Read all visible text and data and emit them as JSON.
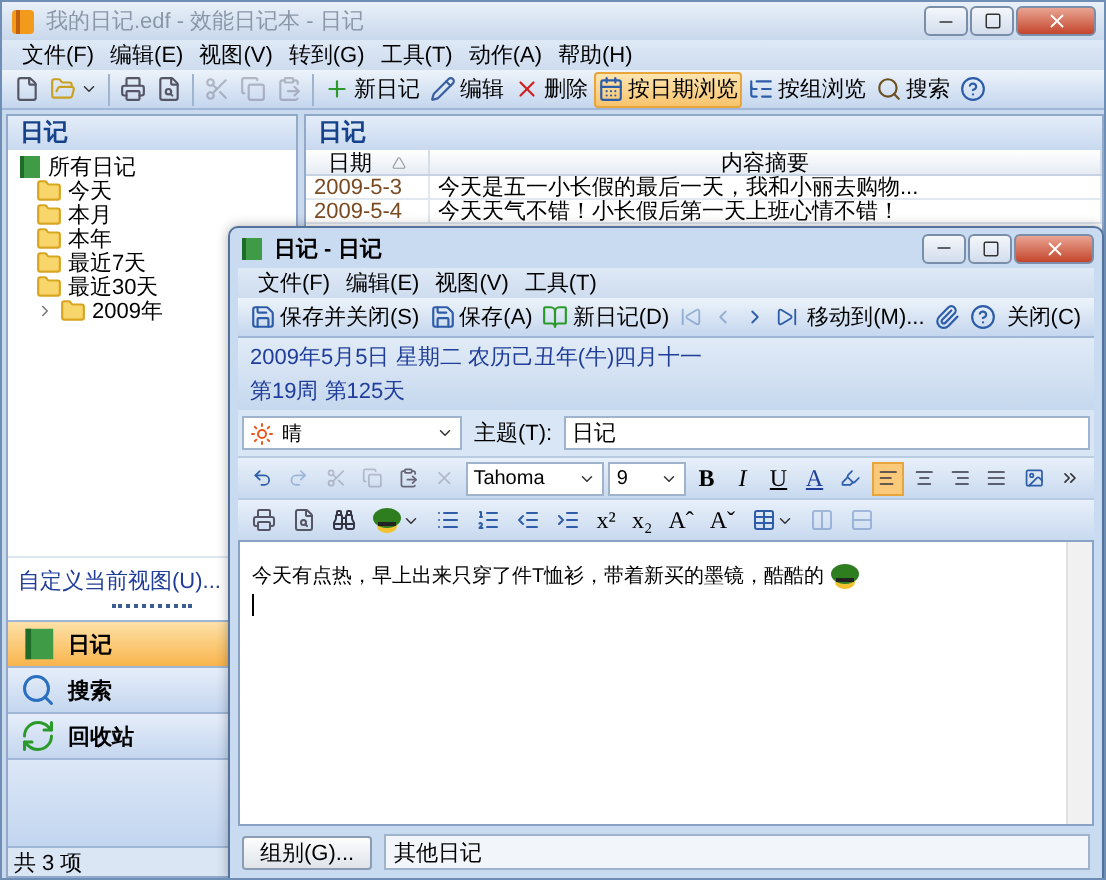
{
  "window": {
    "title": "我的日记.edf - 效能日记本 - 日记"
  },
  "menu": [
    "文件(F)",
    "编辑(E)",
    "视图(V)",
    "转到(G)",
    "工具(T)",
    "动作(A)",
    "帮助(H)"
  ],
  "toolbar": [
    {
      "label": "新日记"
    },
    {
      "label": "编辑"
    },
    {
      "label": "删除"
    },
    {
      "label": "按日期浏览",
      "selected": true
    },
    {
      "label": "按组浏览",
      "selected": false
    },
    {
      "label": "搜索"
    }
  ],
  "sidebar": {
    "title": "日记",
    "tree": [
      {
        "label": "所有日记",
        "children": [
          {
            "label": "今天"
          },
          {
            "label": "本月"
          },
          {
            "label": "本年"
          },
          {
            "label": "最近7天"
          },
          {
            "label": "最近30天"
          },
          {
            "label": "2009年",
            "expanded": false
          }
        ]
      }
    ],
    "customize_link": "自定义当前视图(U)...",
    "nav": [
      {
        "label": "日记",
        "selected": true
      },
      {
        "label": "搜索",
        "selected": false
      },
      {
        "label": "回收站",
        "selected": false
      }
    ],
    "status": "共 3 项"
  },
  "list": {
    "title": "日记",
    "columns": [
      "日期",
      "内容摘要"
    ],
    "rows": [
      [
        "2009-5-3",
        "今天是五一小长假的最后一天，我和小丽去购物..."
      ],
      [
        "2009-5-4",
        "今天天气不错！小长假后第一天上班心情不错！"
      ]
    ]
  },
  "diary_window": {
    "title": "日记 - 日记",
    "menu": [
      "文件(F)",
      "编辑(E)",
      "视图(V)",
      "工具(T)"
    ],
    "toolbar": {
      "save_close": "保存并关闭(S)",
      "save": "保存(A)",
      "new": "新日记(D)",
      "move": "移动到(M)...",
      "close": "关闭(C)"
    },
    "date_line": "2009年5月5日 星期二 农历己丑年(牛)四月十一",
    "week_line": "第19周 第125天",
    "weather": "晴",
    "subject_label": "主题(T):",
    "subject": "日记",
    "font": "Tahoma",
    "font_size": "9",
    "format_buttons": [
      "B",
      "I",
      "U"
    ],
    "font_color_button": "A",
    "align_buttons": [
      {
        "selected": true
      },
      {
        "selected": false
      },
      {
        "selected": false
      },
      {
        "selected": false
      }
    ],
    "script_buttons": [
      "x²",
      "x₂"
    ],
    "size_buttons": [
      "Aˆ",
      "Aˇ"
    ],
    "body": "今天有点热，早上出来只穿了件T恤衫，带着新买的墨镜，酷酷的",
    "group_button": "组别(G)...",
    "group": "其他日记"
  }
}
